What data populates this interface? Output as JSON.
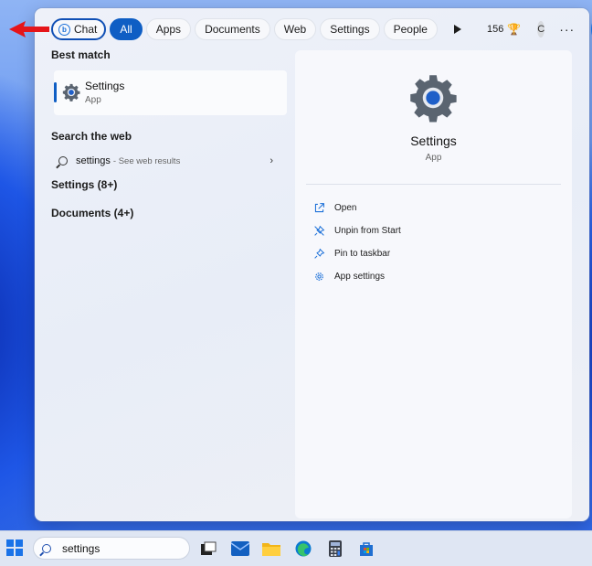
{
  "filters": {
    "chat": "Chat",
    "all": "All",
    "apps": "Apps",
    "documents": "Documents",
    "web": "Web",
    "settings": "Settings",
    "people": "People",
    "points": "156",
    "avatar_initial": "C",
    "more": "···"
  },
  "left": {
    "best_match_heading": "Best match",
    "best_match": {
      "title": "Settings",
      "subtitle": "App"
    },
    "search_web_heading": "Search the web",
    "web_result": {
      "query": "settings",
      "suffix": "- See web results"
    },
    "settings_group": "Settings (8+)",
    "documents_group": "Documents (4+)"
  },
  "preview": {
    "title": "Settings",
    "subtitle": "App",
    "actions": [
      "Open",
      "Unpin from Start",
      "Pin to taskbar",
      "App settings"
    ]
  },
  "taskbar": {
    "search_value": "settings"
  },
  "colors": {
    "accent": "#0f5ec4",
    "arrow": "#e5151a",
    "gear": "#5a6470",
    "gear_center": "#1f5fc8"
  }
}
